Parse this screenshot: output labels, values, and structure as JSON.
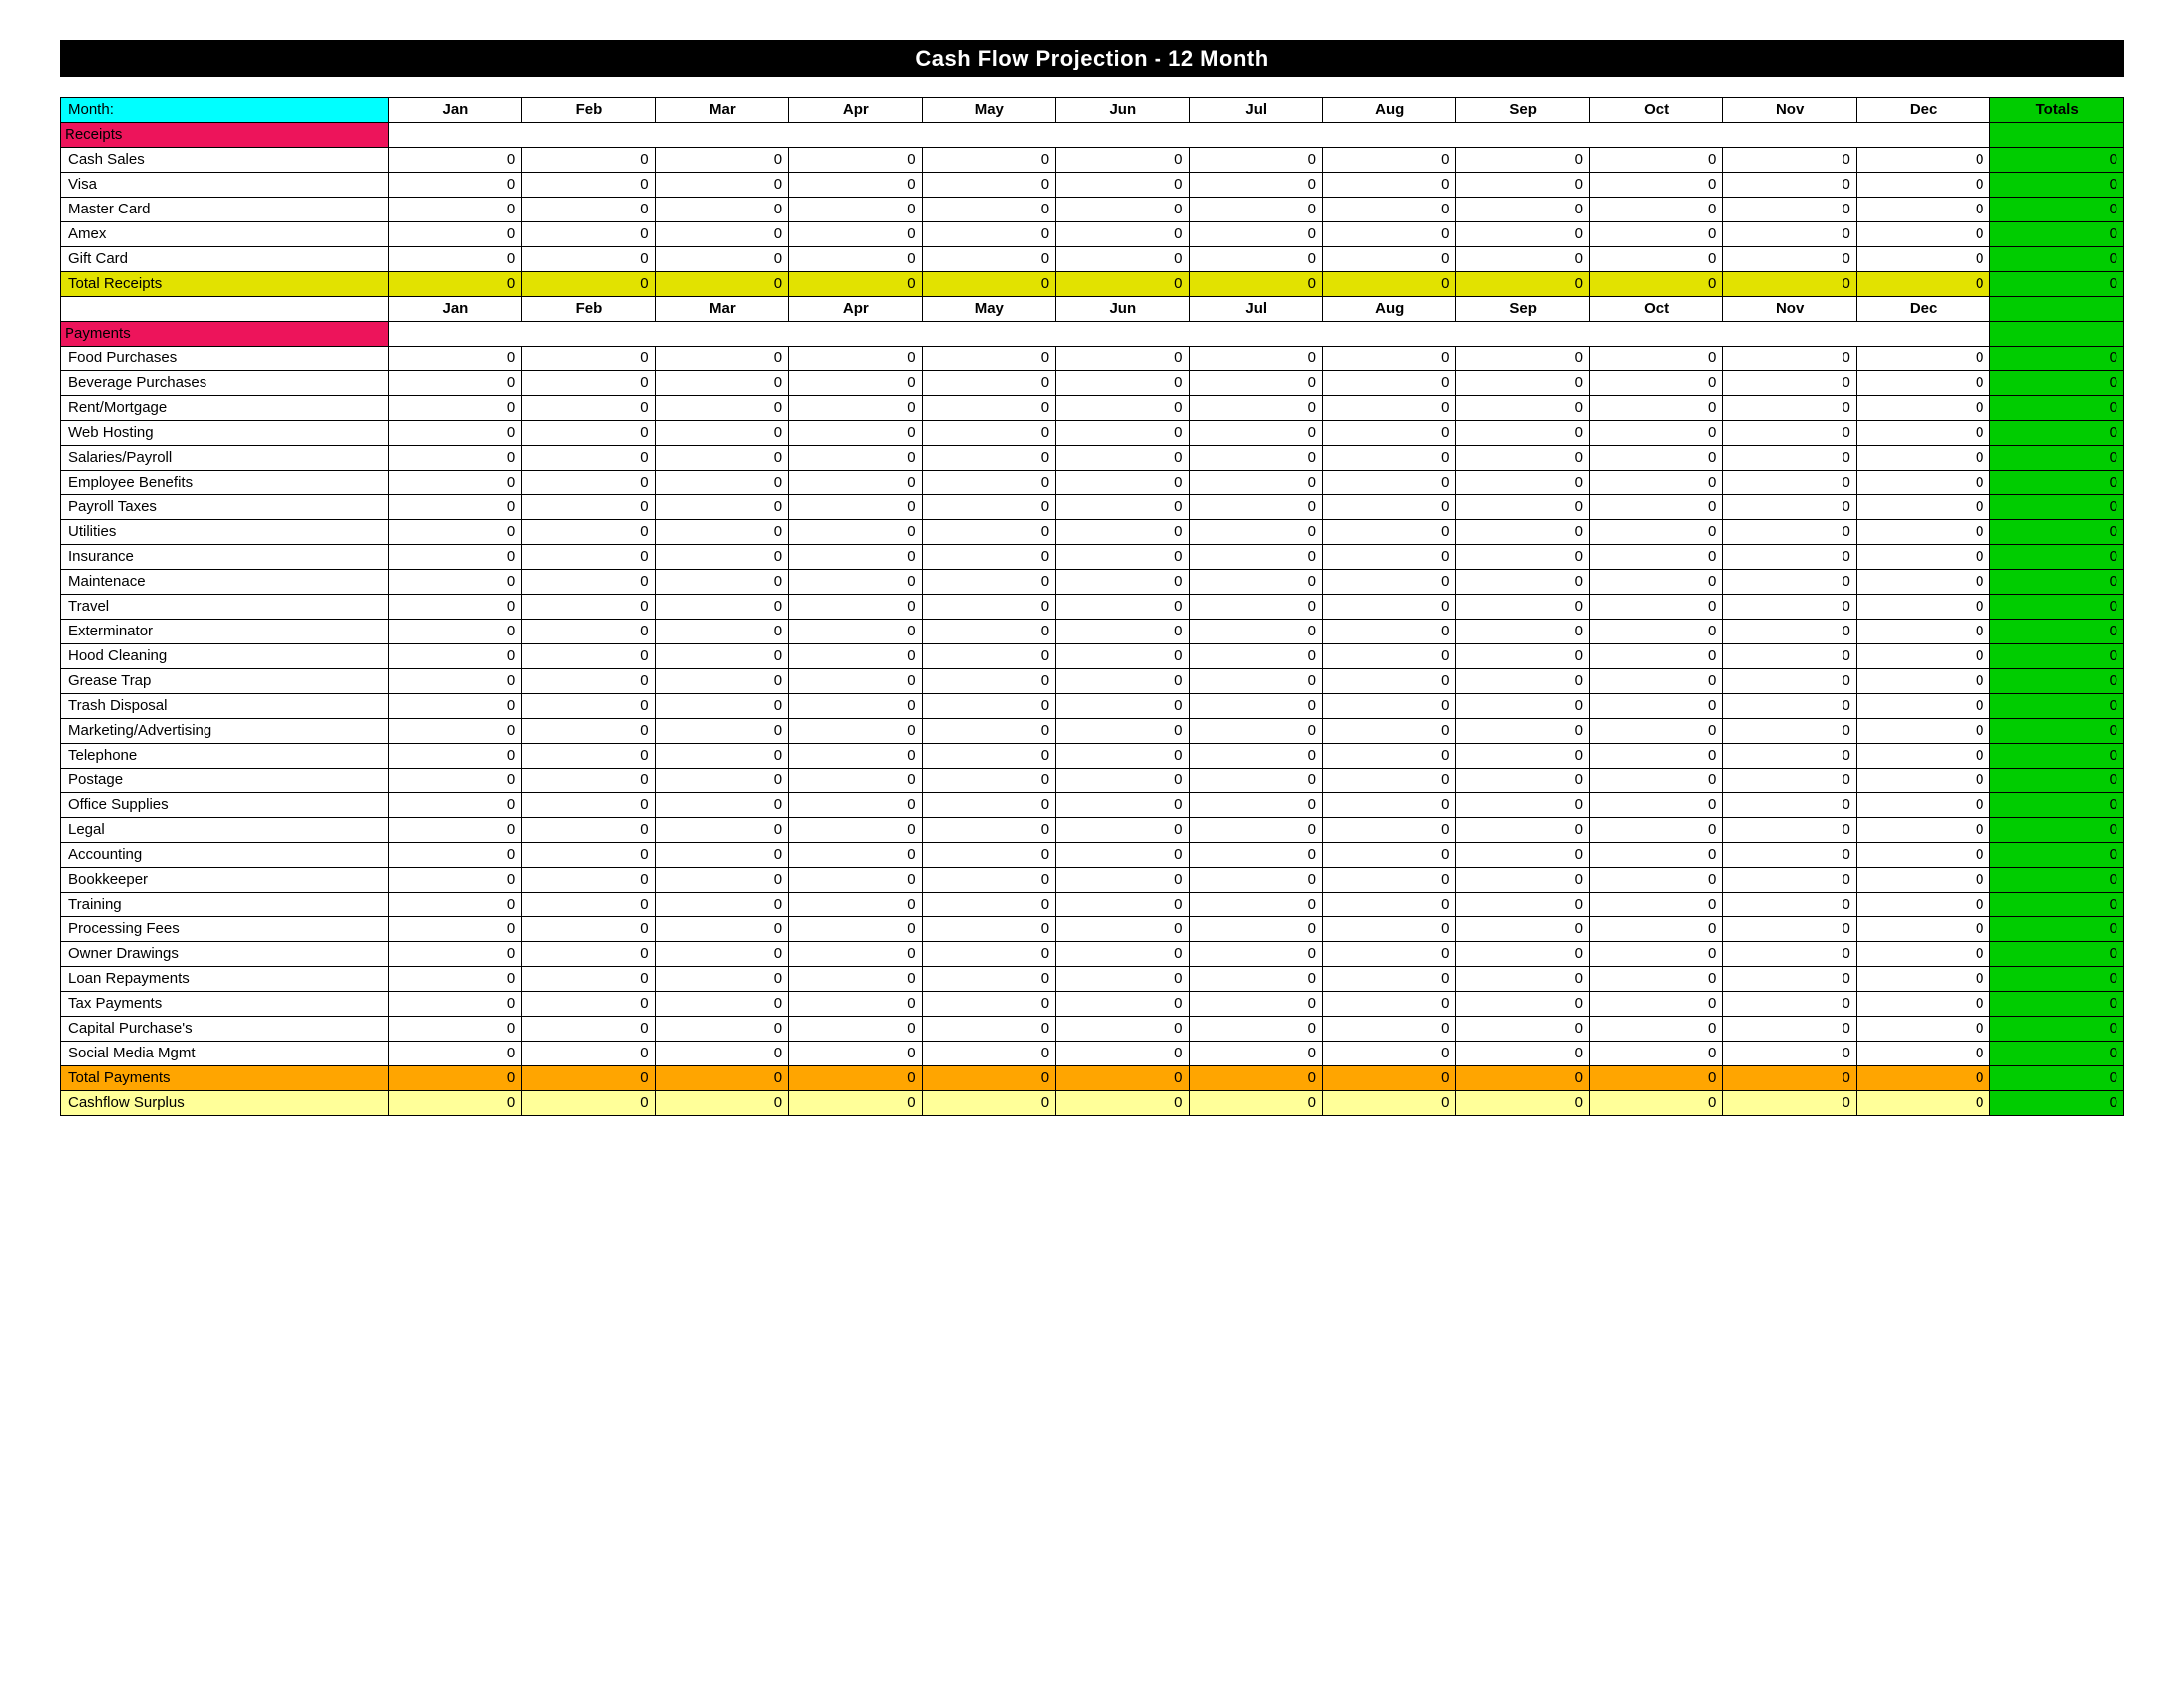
{
  "title": "Cash Flow Projection   -    12 Month",
  "header": {
    "label": "Month:",
    "months": [
      "Jan",
      "Feb",
      "Mar",
      "Apr",
      "May",
      "Jun",
      "Jul",
      "Aug",
      "Sep",
      "Oct",
      "Nov",
      "Dec"
    ],
    "totals": "Totals"
  },
  "sections": {
    "receipts": {
      "label": "Receipts",
      "items": [
        {
          "name": "Cash Sales",
          "values": [
            0,
            0,
            0,
            0,
            0,
            0,
            0,
            0,
            0,
            0,
            0,
            0
          ],
          "total": 0
        },
        {
          "name": "Visa",
          "values": [
            0,
            0,
            0,
            0,
            0,
            0,
            0,
            0,
            0,
            0,
            0,
            0
          ],
          "total": 0
        },
        {
          "name": "Master Card",
          "values": [
            0,
            0,
            0,
            0,
            0,
            0,
            0,
            0,
            0,
            0,
            0,
            0
          ],
          "total": 0
        },
        {
          "name": "Amex",
          "values": [
            0,
            0,
            0,
            0,
            0,
            0,
            0,
            0,
            0,
            0,
            0,
            0
          ],
          "total": 0
        },
        {
          "name": "Gift Card",
          "values": [
            0,
            0,
            0,
            0,
            0,
            0,
            0,
            0,
            0,
            0,
            0,
            0
          ],
          "total": 0
        }
      ],
      "total": {
        "name": "Total Receipts",
        "values": [
          0,
          0,
          0,
          0,
          0,
          0,
          0,
          0,
          0,
          0,
          0,
          0
        ],
        "total": 0
      }
    },
    "payments": {
      "label": "Payments",
      "items": [
        {
          "name": "Food Purchases",
          "values": [
            0,
            0,
            0,
            0,
            0,
            0,
            0,
            0,
            0,
            0,
            0,
            0
          ],
          "total": 0
        },
        {
          "name": "Beverage Purchases",
          "values": [
            0,
            0,
            0,
            0,
            0,
            0,
            0,
            0,
            0,
            0,
            0,
            0
          ],
          "total": 0
        },
        {
          "name": "Rent/Mortgage",
          "values": [
            0,
            0,
            0,
            0,
            0,
            0,
            0,
            0,
            0,
            0,
            0,
            0
          ],
          "total": 0
        },
        {
          "name": "Web Hosting",
          "values": [
            0,
            0,
            0,
            0,
            0,
            0,
            0,
            0,
            0,
            0,
            0,
            0
          ],
          "total": 0
        },
        {
          "name": "Salaries/Payroll",
          "values": [
            0,
            0,
            0,
            0,
            0,
            0,
            0,
            0,
            0,
            0,
            0,
            0
          ],
          "total": 0
        },
        {
          "name": "Employee Benefits",
          "values": [
            0,
            0,
            0,
            0,
            0,
            0,
            0,
            0,
            0,
            0,
            0,
            0
          ],
          "total": 0
        },
        {
          "name": "Payroll Taxes",
          "values": [
            0,
            0,
            0,
            0,
            0,
            0,
            0,
            0,
            0,
            0,
            0,
            0
          ],
          "total": 0
        },
        {
          "name": "Utilities",
          "values": [
            0,
            0,
            0,
            0,
            0,
            0,
            0,
            0,
            0,
            0,
            0,
            0
          ],
          "total": 0
        },
        {
          "name": "Insurance",
          "values": [
            0,
            0,
            0,
            0,
            0,
            0,
            0,
            0,
            0,
            0,
            0,
            0
          ],
          "total": 0
        },
        {
          "name": "Maintenace",
          "values": [
            0,
            0,
            0,
            0,
            0,
            0,
            0,
            0,
            0,
            0,
            0,
            0
          ],
          "total": 0
        },
        {
          "name": "Travel",
          "values": [
            0,
            0,
            0,
            0,
            0,
            0,
            0,
            0,
            0,
            0,
            0,
            0
          ],
          "total": 0
        },
        {
          "name": "Exterminator",
          "values": [
            0,
            0,
            0,
            0,
            0,
            0,
            0,
            0,
            0,
            0,
            0,
            0
          ],
          "total": 0
        },
        {
          "name": "Hood Cleaning",
          "values": [
            0,
            0,
            0,
            0,
            0,
            0,
            0,
            0,
            0,
            0,
            0,
            0
          ],
          "total": 0
        },
        {
          "name": "Grease Trap",
          "values": [
            0,
            0,
            0,
            0,
            0,
            0,
            0,
            0,
            0,
            0,
            0,
            0
          ],
          "total": 0
        },
        {
          "name": "Trash Disposal",
          "values": [
            0,
            0,
            0,
            0,
            0,
            0,
            0,
            0,
            0,
            0,
            0,
            0
          ],
          "total": 0
        },
        {
          "name": "Marketing/Advertising",
          "values": [
            0,
            0,
            0,
            0,
            0,
            0,
            0,
            0,
            0,
            0,
            0,
            0
          ],
          "total": 0
        },
        {
          "name": "Telephone",
          "values": [
            0,
            0,
            0,
            0,
            0,
            0,
            0,
            0,
            0,
            0,
            0,
            0
          ],
          "total": 0
        },
        {
          "name": "Postage",
          "values": [
            0,
            0,
            0,
            0,
            0,
            0,
            0,
            0,
            0,
            0,
            0,
            0
          ],
          "total": 0
        },
        {
          "name": "Office Supplies",
          "values": [
            0,
            0,
            0,
            0,
            0,
            0,
            0,
            0,
            0,
            0,
            0,
            0
          ],
          "total": 0
        },
        {
          "name": "Legal",
          "values": [
            0,
            0,
            0,
            0,
            0,
            0,
            0,
            0,
            0,
            0,
            0,
            0
          ],
          "total": 0
        },
        {
          "name": "Accounting",
          "values": [
            0,
            0,
            0,
            0,
            0,
            0,
            0,
            0,
            0,
            0,
            0,
            0
          ],
          "total": 0
        },
        {
          "name": "Bookkeeper",
          "values": [
            0,
            0,
            0,
            0,
            0,
            0,
            0,
            0,
            0,
            0,
            0,
            0
          ],
          "total": 0
        },
        {
          "name": "Training",
          "values": [
            0,
            0,
            0,
            0,
            0,
            0,
            0,
            0,
            0,
            0,
            0,
            0
          ],
          "total": 0
        },
        {
          "name": "Processing Fees",
          "values": [
            0,
            0,
            0,
            0,
            0,
            0,
            0,
            0,
            0,
            0,
            0,
            0
          ],
          "total": 0
        },
        {
          "name": "Owner Drawings",
          "values": [
            0,
            0,
            0,
            0,
            0,
            0,
            0,
            0,
            0,
            0,
            0,
            0
          ],
          "total": 0
        },
        {
          "name": "Loan Repayments",
          "values": [
            0,
            0,
            0,
            0,
            0,
            0,
            0,
            0,
            0,
            0,
            0,
            0
          ],
          "total": 0
        },
        {
          "name": "Tax Payments",
          "values": [
            0,
            0,
            0,
            0,
            0,
            0,
            0,
            0,
            0,
            0,
            0,
            0
          ],
          "total": 0
        },
        {
          "name": "Capital Purchase's",
          "values": [
            0,
            0,
            0,
            0,
            0,
            0,
            0,
            0,
            0,
            0,
            0,
            0
          ],
          "total": 0
        },
        {
          "name": "Social Media Mgmt",
          "values": [
            0,
            0,
            0,
            0,
            0,
            0,
            0,
            0,
            0,
            0,
            0,
            0
          ],
          "total": 0
        }
      ],
      "total": {
        "name": "Total Payments",
        "values": [
          0,
          0,
          0,
          0,
          0,
          0,
          0,
          0,
          0,
          0,
          0,
          0
        ],
        "total": 0
      }
    },
    "surplus": {
      "name": "Cashflow Surplus",
      "values": [
        0,
        0,
        0,
        0,
        0,
        0,
        0,
        0,
        0,
        0,
        0,
        0
      ],
      "total": 0
    }
  }
}
